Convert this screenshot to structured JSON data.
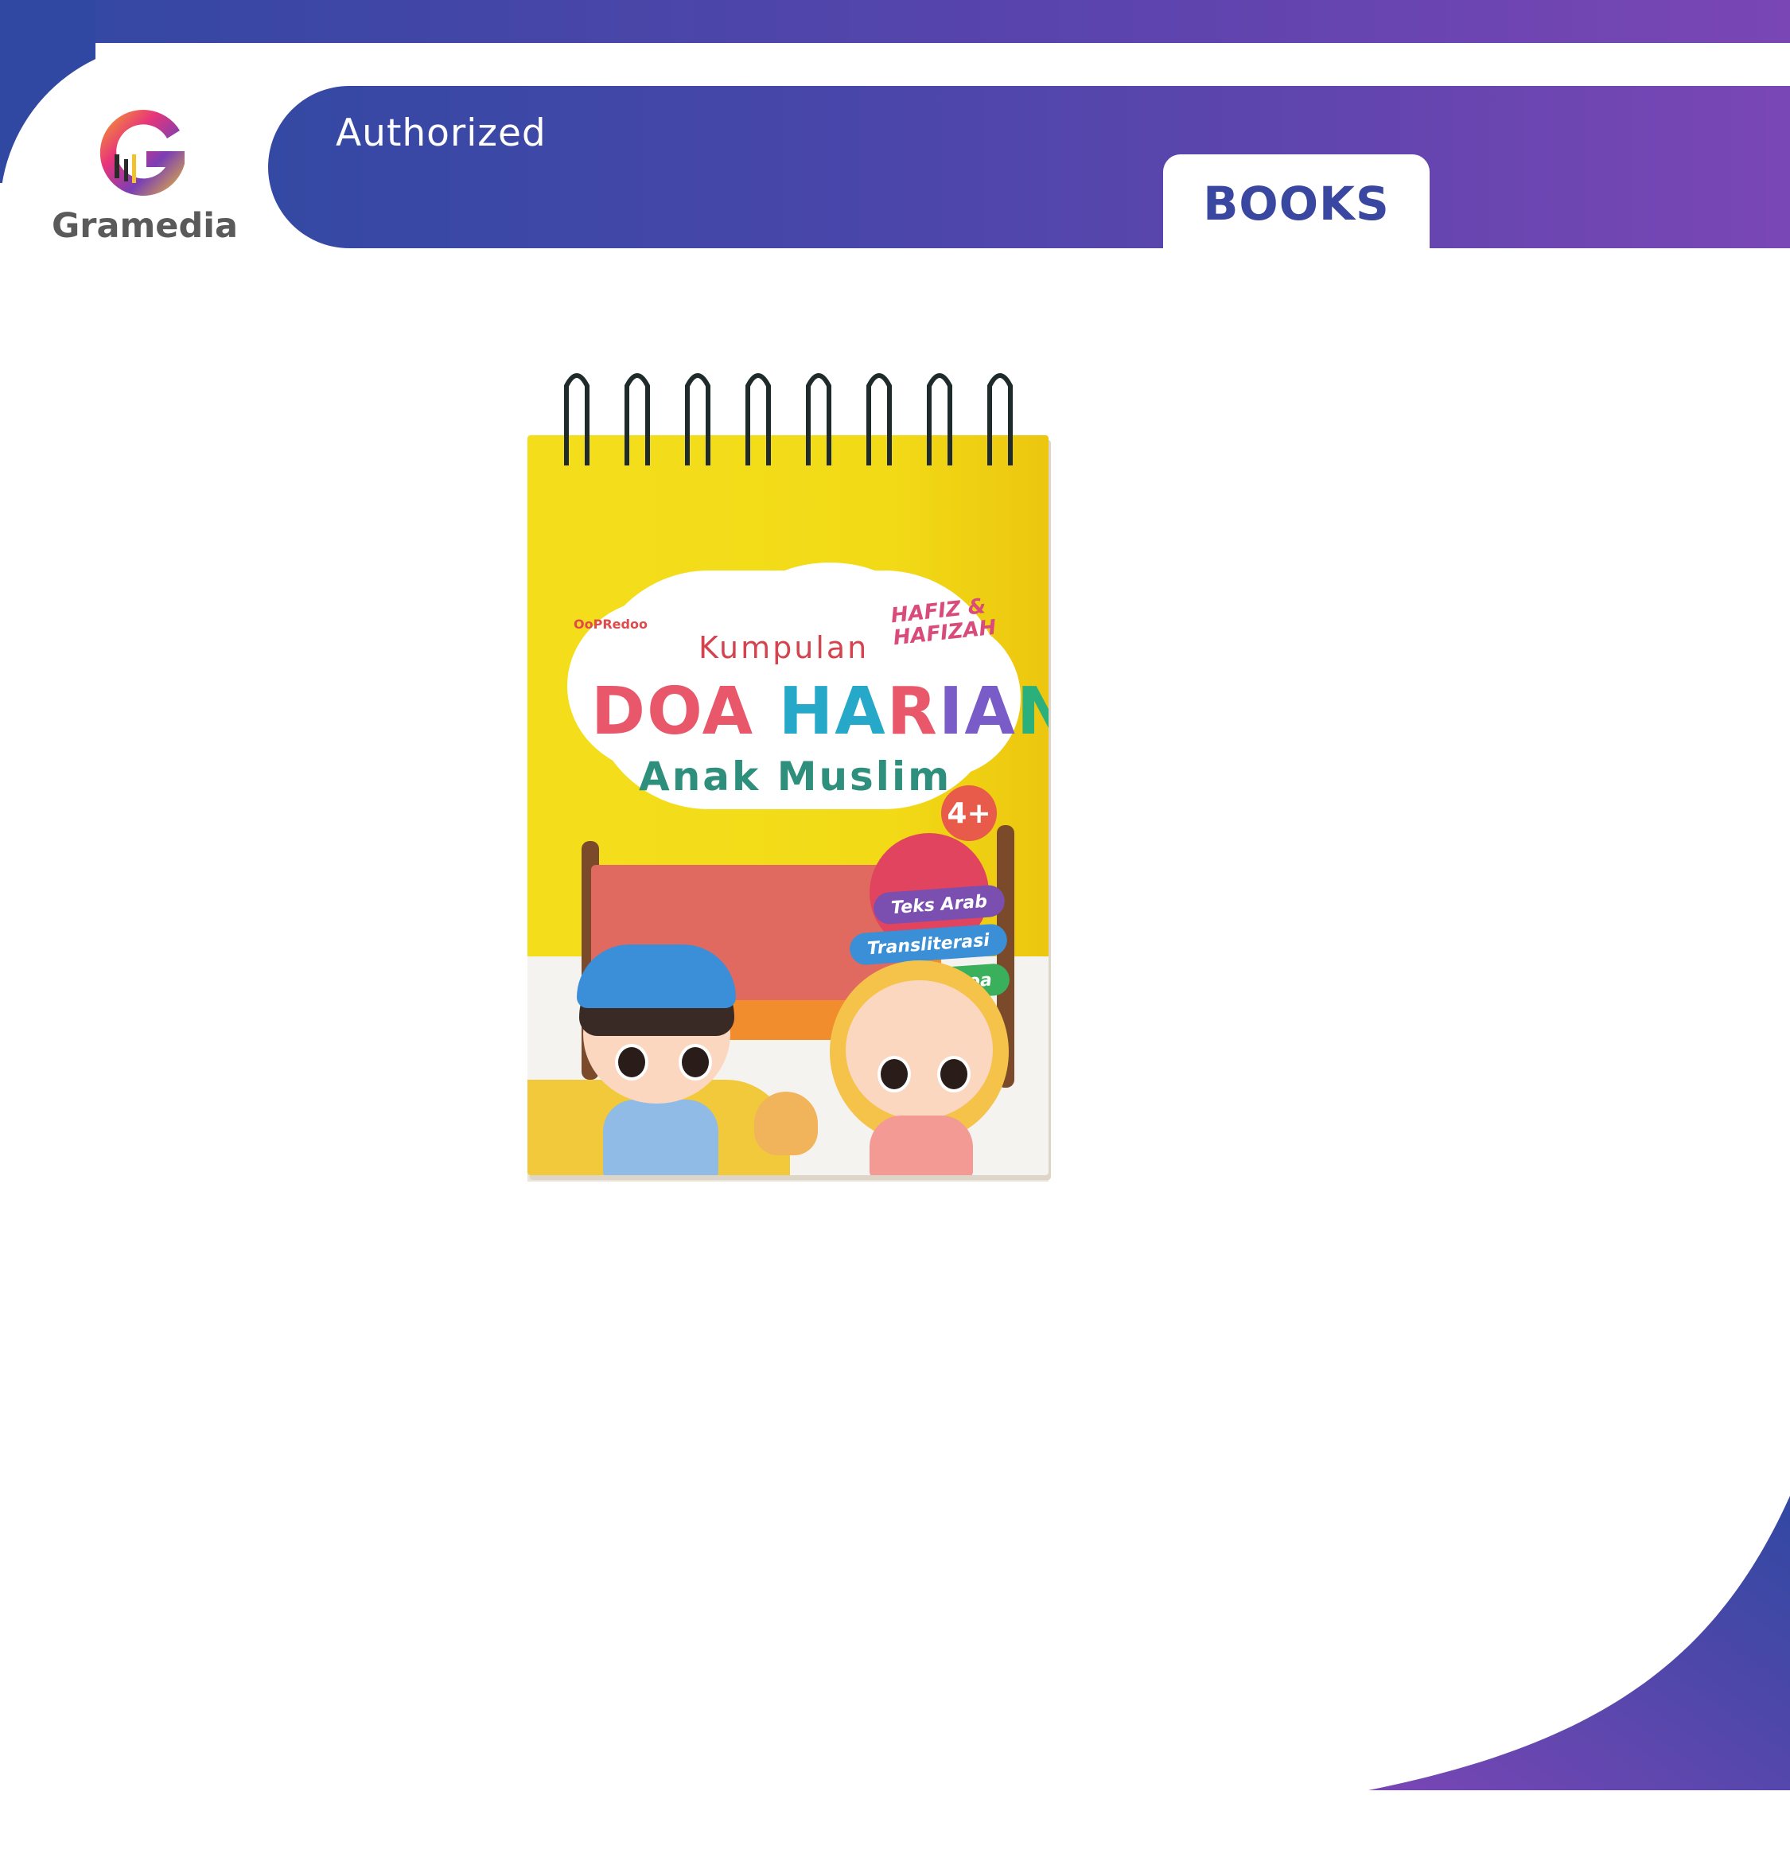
{
  "brand": {
    "logo_text": "Gramedia",
    "colors": {
      "primary": "#3148a2",
      "secondary": "#7a46b5",
      "text_gray": "#5a5a5a",
      "books_text": "#3a47a0"
    }
  },
  "banner": {
    "authorized_label": "Authorized",
    "books_label": "BOOKS"
  },
  "product": {
    "publisher": "OoPRedoo",
    "series": "HAFIZ & HAFIZAH",
    "title_top": "Kumpulan",
    "title_main": "DOA HARIAN",
    "title_main_letters": [
      "DOA",
      " ",
      "HA",
      "R",
      "IA",
      "N"
    ],
    "title_sub": "Anak Muslim",
    "age_badge": "4+",
    "features": [
      "Teks Arab",
      "Transliterasi",
      "Arti Doa"
    ],
    "cover_color": "#f4de1c"
  }
}
